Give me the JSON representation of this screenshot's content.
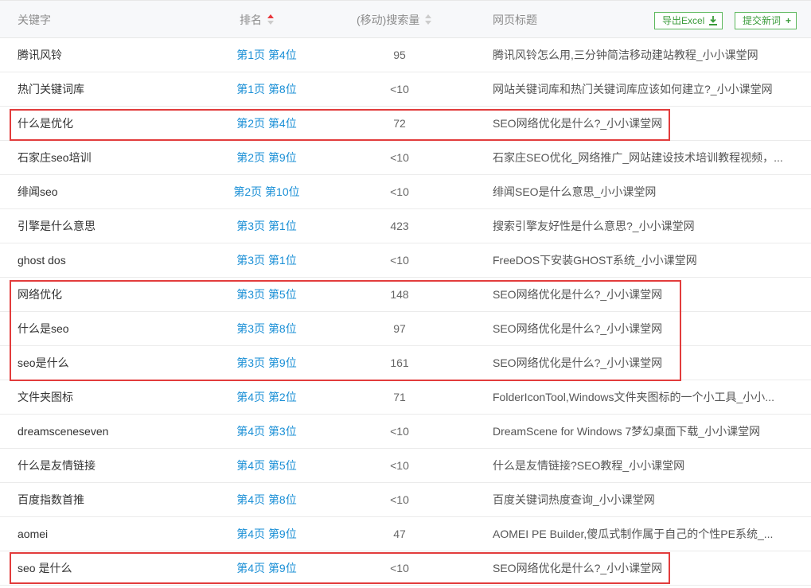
{
  "header": {
    "keyword": "关键字",
    "rank": "排名",
    "volume": "(移动)搜索量",
    "title": "网页标题",
    "export_button": "导出Excel",
    "submit_button": "提交新词"
  },
  "colors": {
    "highlight": "#e23c3c",
    "link": "#1a8fd6",
    "accent": "#5cb85c",
    "sort_active": "#e8383d"
  },
  "rows": [
    {
      "keyword": "腾讯风铃",
      "page": "第1页",
      "pos": "第4位",
      "volume": "95",
      "title": "腾讯风铃怎么用,三分钟简洁移动建站教程_小小课堂网"
    },
    {
      "keyword": "热门关键词库",
      "page": "第1页",
      "pos": "第8位",
      "volume": "<10",
      "title": "网站关键词库和热门关键词库应该如何建立?_小小课堂网"
    },
    {
      "keyword": "什么是优化",
      "page": "第2页",
      "pos": "第4位",
      "volume": "72",
      "title": "SEO网络优化是什么?_小小课堂网"
    },
    {
      "keyword": "石家庄seo培训",
      "page": "第2页",
      "pos": "第9位",
      "volume": "<10",
      "title": "石家庄SEO优化_网络推广_网站建设技术培训教程视频，..."
    },
    {
      "keyword": "绯闻seo",
      "page": "第2页",
      "pos": "第10位",
      "volume": "<10",
      "title": "绯闻SEO是什么意思_小小课堂网"
    },
    {
      "keyword": "引擎是什么意思",
      "page": "第3页",
      "pos": "第1位",
      "volume": "423",
      "title": "搜索引擎友好性是什么意思?_小小课堂网"
    },
    {
      "keyword": "ghost dos",
      "page": "第3页",
      "pos": "第1位",
      "volume": "<10",
      "title": "FreeDOS下安装GHOST系统_小小课堂网"
    },
    {
      "keyword": "网络优化",
      "page": "第3页",
      "pos": "第5位",
      "volume": "148",
      "title": "SEO网络优化是什么?_小小课堂网"
    },
    {
      "keyword": "什么是seo",
      "page": "第3页",
      "pos": "第8位",
      "volume": "97",
      "title": "SEO网络优化是什么?_小小课堂网"
    },
    {
      "keyword": "seo是什么",
      "page": "第3页",
      "pos": "第9位",
      "volume": "161",
      "title": "SEO网络优化是什么?_小小课堂网"
    },
    {
      "keyword": "文件夹图标",
      "page": "第4页",
      "pos": "第2位",
      "volume": "71",
      "title": "FolderIconTool,Windows文件夹图标的一个小工具_小小..."
    },
    {
      "keyword": "dreamsceneseven",
      "page": "第4页",
      "pos": "第3位",
      "volume": "<10",
      "title": "DreamScene for Windows 7梦幻桌面下载_小小课堂网"
    },
    {
      "keyword": "什么是友情链接",
      "page": "第4页",
      "pos": "第5位",
      "volume": "<10",
      "title": "什么是友情链接?SEO教程_小小课堂网"
    },
    {
      "keyword": "百度指数首推",
      "page": "第4页",
      "pos": "第8位",
      "volume": "<10",
      "title": "百度关键词热度查询_小小课堂网"
    },
    {
      "keyword": "aomei",
      "page": "第4页",
      "pos": "第9位",
      "volume": "47",
      "title": "AOMEI PE Builder,傻瓜式制作属于自己的个性PE系统_..."
    },
    {
      "keyword": "seo 是什么",
      "page": "第4页",
      "pos": "第9位",
      "volume": "<10",
      "title": "SEO网络优化是什么?_小小课堂网"
    }
  ]
}
